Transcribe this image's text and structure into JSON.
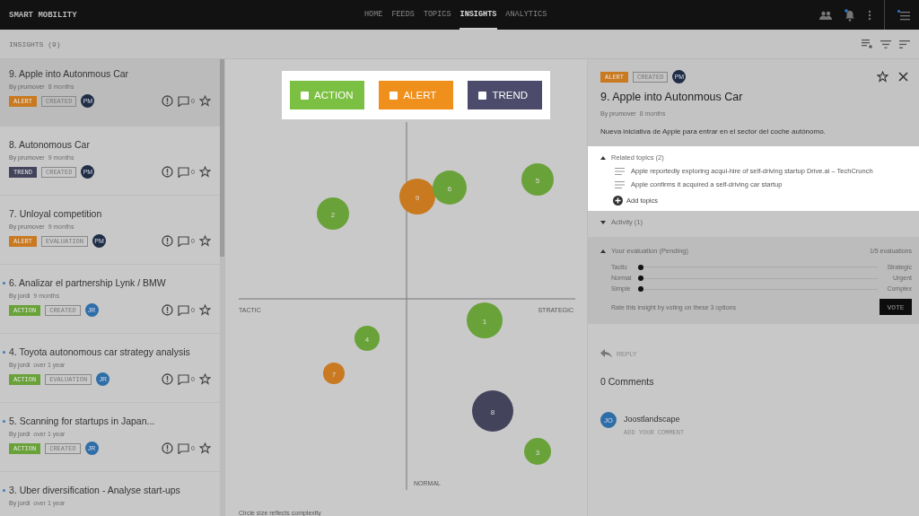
{
  "app": {
    "title": "SMART MOBILITY"
  },
  "nav": [
    {
      "label": "HOME",
      "selected": false
    },
    {
      "label": "FEEDS",
      "selected": false
    },
    {
      "label": "TOPICS",
      "selected": false
    },
    {
      "label": "INSIGHTS",
      "selected": true
    },
    {
      "label": "ANALYTICS",
      "selected": false
    }
  ],
  "toolbar": {
    "title": "INSIGHTS (9)"
  },
  "insights": [
    {
      "title": "9. Apple into Autonmous Car",
      "author": "By prumover",
      "time": "8 months",
      "kind": "alert",
      "type_label": "ALERT",
      "status": "CREATED",
      "avatar": "PM",
      "comments": "0",
      "unread": false,
      "selected": true,
      "badges_visible": true
    },
    {
      "title": "8. Autonomous Car",
      "author": "By prumover",
      "time": "9 months",
      "kind": "trend",
      "type_label": "TREND",
      "status": "CREATED",
      "avatar": "PM",
      "comments": "0",
      "unread": false,
      "selected": false,
      "badges_visible": true
    },
    {
      "title": "7. Unloyal competition",
      "author": "By prumover",
      "time": "9 months",
      "kind": "alert",
      "type_label": "ALERT",
      "status": "EVALUATION",
      "avatar": "PM",
      "comments": "0",
      "unread": false,
      "selected": false,
      "badges_visible": true
    },
    {
      "title": "6. Analizar el partnership Lynk / BMW",
      "author": "By jordi",
      "time": "9 months",
      "kind": "action",
      "type_label": "ACTION",
      "status": "CREATED",
      "avatar": "JR",
      "comments": "0",
      "unread": true,
      "selected": false,
      "badges_visible": true
    },
    {
      "title": "4. Toyota autonomous car strategy analysis",
      "author": "By jordi",
      "time": "over 1 year",
      "kind": "action",
      "type_label": "ACTION",
      "status": "EVALUATION",
      "avatar": "JR",
      "comments": "0",
      "unread": true,
      "selected": false,
      "badges_visible": true
    },
    {
      "title": "5. Scanning for startups in Japan...",
      "author": "By jordi",
      "time": "over 1 year",
      "kind": "action",
      "type_label": "ACTION",
      "status": "CREATED",
      "avatar": "JR",
      "comments": "0",
      "unread": true,
      "selected": false,
      "badges_visible": true
    },
    {
      "title": "3. Uber diversification - Analyse start-ups",
      "author": "By jordi",
      "time": "over 1 year",
      "unread": true,
      "selected": false,
      "badges_visible": false
    }
  ],
  "legend": [
    {
      "label": "ACTION",
      "kind": "action",
      "checked": false
    },
    {
      "label": "ALERT",
      "kind": "alert",
      "checked": false
    },
    {
      "label": "TREND",
      "kind": "trend",
      "checked": false
    }
  ],
  "matrix": {
    "left_label": "TACTIC",
    "right_label": "STRATEGIC",
    "bottom_label": "NORMAL",
    "caption": "Circle size reflects complexity",
    "bubbles": [
      {
        "label": "9",
        "kind": "alert"
      },
      {
        "label": "6",
        "kind": "action"
      },
      {
        "label": "5",
        "kind": "action"
      },
      {
        "label": "2",
        "kind": "action"
      },
      {
        "label": "1",
        "kind": "action"
      },
      {
        "label": "4",
        "kind": "action"
      },
      {
        "label": "7",
        "kind": "alert"
      },
      {
        "label": "8",
        "kind": "trend"
      },
      {
        "label": "3",
        "kind": "action"
      }
    ]
  },
  "detail": {
    "kind": "alert",
    "type_label": "ALERT",
    "status": "CREATED",
    "avatar": "PM",
    "title": "9. Apple into Autonmous Car",
    "author": "By prumover",
    "time": "8 months",
    "description": "Nueva iniciativa de Apple para entrar en el sector del coche autónomo.",
    "related": {
      "title": "Related topics (2)",
      "expanded": true,
      "items": [
        "Apple reportedly exploring acqui-hire of self-driving startup Drive.ai – TechCrunch",
        "Apple confirms it acquired a self-driving car startup"
      ],
      "add": "Add topics"
    },
    "activity": {
      "title": "Activity (1)",
      "expanded": false
    },
    "evaluation": {
      "title": "Your evaluation (Pending)",
      "count": "1/5 evaluations",
      "expanded": true,
      "scales": [
        {
          "left": "Tactic",
          "right": "Strategic",
          "level": 0
        },
        {
          "left": "Normal",
          "right": "Urgent",
          "level": 0
        },
        {
          "left": "Simple",
          "right": "Complex",
          "level": 0
        }
      ],
      "hint": "Rate this insight by voting on these 3 options",
      "button": "VOTE"
    },
    "reply": "REPLY",
    "comments_title": "0 Comments",
    "commenter": {
      "avatar": "JO",
      "name": "Joostlandscape",
      "placeholder": "ADD YOUR COMMENT"
    }
  }
}
